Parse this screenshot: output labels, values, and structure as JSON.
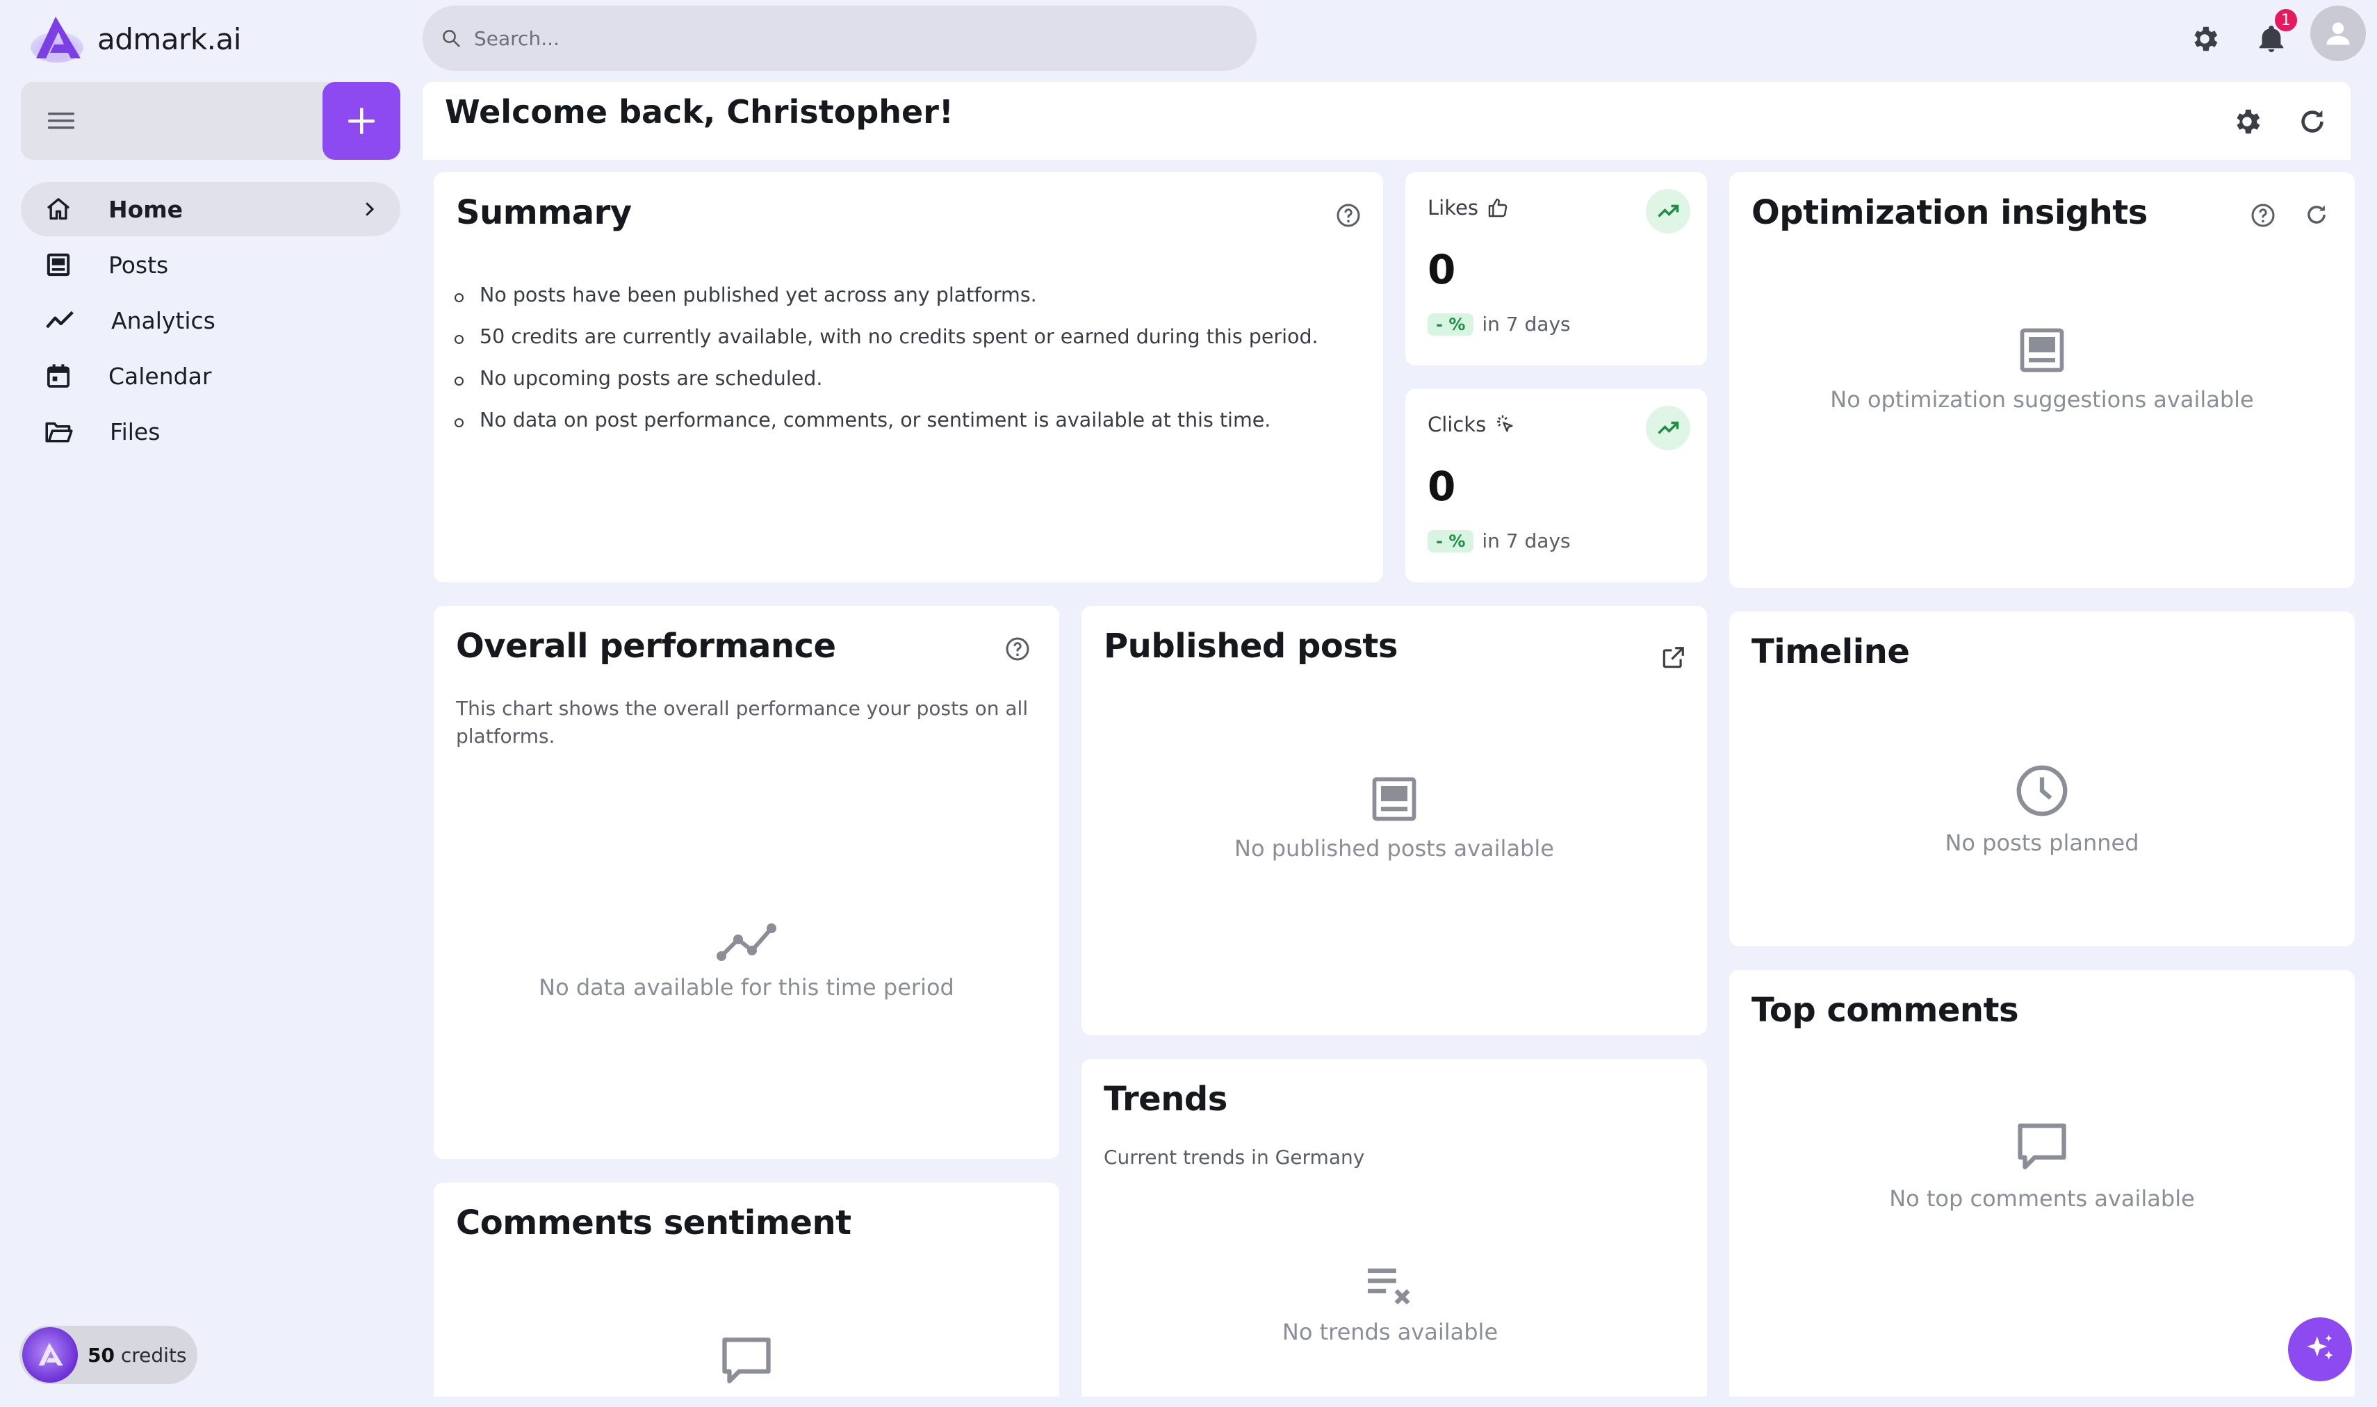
{
  "app": {
    "name": "admark.ai"
  },
  "search": {
    "placeholder": "Search..."
  },
  "notifications": {
    "count": "1"
  },
  "sidebar": {
    "items": [
      {
        "label": "Home",
        "icon": "home-icon"
      },
      {
        "label": "Posts",
        "icon": "posts-icon"
      },
      {
        "label": "Analytics",
        "icon": "analytics-icon"
      },
      {
        "label": "Calendar",
        "icon": "calendar-icon"
      },
      {
        "label": "Files",
        "icon": "folder-icon"
      }
    ],
    "credits_amount": "50",
    "credits_label": "credits"
  },
  "welcome": {
    "title": "Welcome back, Christopher!"
  },
  "summary": {
    "title": "Summary",
    "items": [
      "No posts have been published yet across any platforms.",
      "50 credits are currently available, with no credits spent or earned during this period.",
      "No upcoming posts are scheduled.",
      "No data on post performance, comments, or sentiment is available at this time."
    ]
  },
  "likes": {
    "label": "Likes",
    "value": "0",
    "pct": "- %",
    "period": "in 7 days"
  },
  "clicks": {
    "label": "Clicks",
    "value": "0",
    "pct": "- %",
    "period": "in 7 days"
  },
  "optimization": {
    "title": "Optimization insights",
    "empty": "No optimization suggestions available"
  },
  "performance": {
    "title": "Overall performance",
    "description": "This chart shows the overall performance your posts on all platforms.",
    "empty": "No data available for this time period"
  },
  "published": {
    "title": "Published posts",
    "empty": "No published posts available"
  },
  "timeline": {
    "title": "Timeline",
    "empty": "No posts planned"
  },
  "trends": {
    "title": "Trends",
    "subtitle": "Current trends in Germany",
    "empty": "No trends available"
  },
  "top_comments": {
    "title": "Top comments",
    "empty": "No top comments available"
  },
  "sentiment": {
    "title": "Comments sentiment"
  },
  "colors": {
    "accent": "#8c4af0",
    "background": "#eef0fb",
    "badge": "#e5195e",
    "positive": "#1f8f46"
  }
}
